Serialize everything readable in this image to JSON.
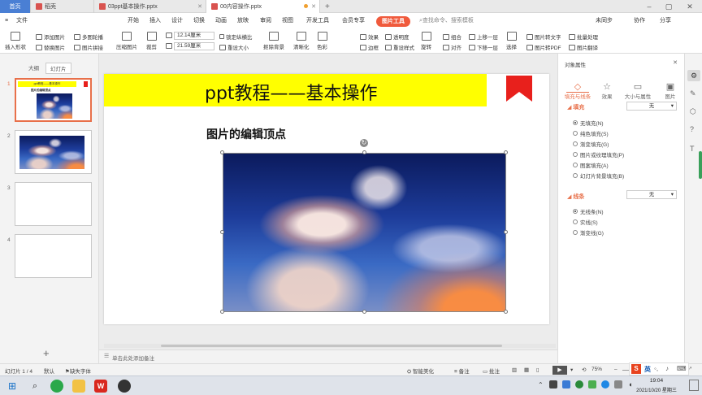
{
  "titlebar": {
    "tabs": [
      {
        "label": "首页"
      },
      {
        "label": "稻壳"
      },
      {
        "label": "03ppt基本操作.pptx"
      },
      {
        "label": "00内容操作.pptx"
      }
    ]
  },
  "menubar": {
    "file": "文件",
    "items": [
      "开始",
      "插入",
      "设计",
      "切换",
      "动画",
      "放映",
      "审阅",
      "视图",
      "开发工具",
      "会员专享"
    ],
    "active": "图片工具",
    "search": "查找命令、搜索模板",
    "right": [
      "未同步",
      "协作",
      "分享"
    ]
  },
  "ribbon": {
    "insert_shape": "插入形状",
    "add_picture": "添加图片",
    "replace_picture": "替换图片",
    "multi_carousel": "多图轮播",
    "picture_splice": "图片拼接",
    "compress": "压缩图片",
    "crop": "裁剪",
    "width": "12.14厘米",
    "height": "21.59厘米",
    "lock_ratio": "锁定纵横比",
    "reset_size": "重设大小",
    "remove_bg": "抠除背景",
    "clarity": "清晰化",
    "color": "色彩",
    "effects": "效果",
    "transparency": "透明度",
    "border": "边框",
    "reset_style": "重设样式",
    "rotate": "旋转",
    "align": "对齐",
    "group": "组合",
    "bring_forward": "上移一层",
    "send_backward": "下移一层",
    "select": "选择",
    "to_text": "图片转文字",
    "to_pdf": "图片转PDF",
    "batch": "批量处理",
    "translate": "图片翻译"
  },
  "leftpanel": {
    "tabs": [
      "大纲",
      "幻灯片"
    ],
    "slides": [
      "1",
      "2",
      "3",
      "4"
    ],
    "thumb_title": "ppt教程——基本操作",
    "thumb_sub": "图片的编辑顶点"
  },
  "slide": {
    "title": "ppt教程——基本操作",
    "subtitle": "图片的编辑顶点"
  },
  "notes": {
    "placeholder": "单击此处添加备注"
  },
  "rightpanel": {
    "header": "对象属性",
    "tabs": [
      "填充与线条",
      "效果",
      "大小与属性",
      "图片"
    ],
    "fill_section": "填充",
    "fill_value": "无",
    "fill_options": [
      "无填充(N)",
      "纯色填充(S)",
      "渐变填充(G)",
      "图片或纹理填充(P)",
      "图案填充(A)",
      "幻灯片背景填充(B)"
    ],
    "line_section": "线条",
    "line_value": "无",
    "line_options": [
      "无线条(N)",
      "实线(S)",
      "渐变线(G)"
    ]
  },
  "statusbar": {
    "slide_info": "幻灯片 1 / 4",
    "theme": "默认",
    "font_missing": "缺失字体",
    "beautify": "智能美化",
    "notes": "备注",
    "comments": "批注",
    "zoom": "75%"
  },
  "taskbar": {
    "ime": "英",
    "time": "19:04",
    "date": "2021/10/20 星期三"
  },
  "colors": {
    "accent": "#f05a3c",
    "home_tab": "#4a7fd4",
    "title_band": "#ffff00",
    "bookmark": "#e8201c"
  }
}
